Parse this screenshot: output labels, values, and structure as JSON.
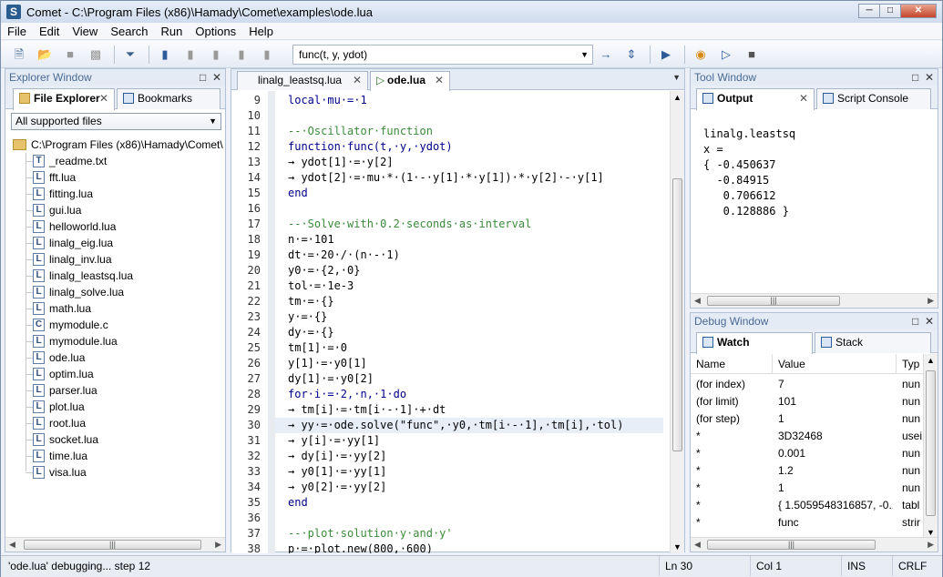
{
  "window": {
    "title": "Comet - C:\\Program Files (x86)\\Hamady\\Comet\\examples\\ode.lua",
    "buttons": [
      "minimize",
      "maximize",
      "close"
    ]
  },
  "menu": [
    "File",
    "Edit",
    "View",
    "Search",
    "Run",
    "Options",
    "Help"
  ],
  "toolbar": {
    "function_combo": "func(t, y, ydot)"
  },
  "explorer": {
    "title": "Explorer Window",
    "tabs": [
      {
        "label": "File Explorer",
        "active": true
      },
      {
        "label": "Bookmarks",
        "active": false
      }
    ],
    "filter": "All supported files",
    "root": "C:\\Program Files (x86)\\Hamady\\Comet\\",
    "files": [
      {
        "name": "_readme.txt",
        "icon": "T"
      },
      {
        "name": "fft.lua",
        "icon": "L"
      },
      {
        "name": "fitting.lua",
        "icon": "L"
      },
      {
        "name": "gui.lua",
        "icon": "L"
      },
      {
        "name": "helloworld.lua",
        "icon": "L"
      },
      {
        "name": "linalg_eig.lua",
        "icon": "L"
      },
      {
        "name": "linalg_inv.lua",
        "icon": "L"
      },
      {
        "name": "linalg_leastsq.lua",
        "icon": "L"
      },
      {
        "name": "linalg_solve.lua",
        "icon": "L"
      },
      {
        "name": "math.lua",
        "icon": "L"
      },
      {
        "name": "mymodule.c",
        "icon": "C"
      },
      {
        "name": "mymodule.lua",
        "icon": "L"
      },
      {
        "name": "ode.lua",
        "icon": "L"
      },
      {
        "name": "optim.lua",
        "icon": "L"
      },
      {
        "name": "parser.lua",
        "icon": "L"
      },
      {
        "name": "plot.lua",
        "icon": "L"
      },
      {
        "name": "root.lua",
        "icon": "L"
      },
      {
        "name": "socket.lua",
        "icon": "L"
      },
      {
        "name": "time.lua",
        "icon": "L"
      },
      {
        "name": "visa.lua",
        "icon": "L"
      }
    ]
  },
  "editor": {
    "tabs": [
      {
        "label": "linalg_leastsq.lua",
        "active": false
      },
      {
        "label": "ode.lua",
        "active": true
      }
    ],
    "current_line": 30,
    "lines": [
      {
        "n": "9",
        "t": "local·mu·=·1"
      },
      {
        "n": "10",
        "t": ""
      },
      {
        "n": "11",
        "t": "--·Oscillator·function"
      },
      {
        "n": "12",
        "t": "function·func(t,·y,·ydot)"
      },
      {
        "n": "13",
        "t": "→ ydot[1]·=·y[2]"
      },
      {
        "n": "14",
        "t": "→ ydot[2]·=·mu·*·(1·-·y[1]·*·y[1])·*·y[2]·-·y[1]"
      },
      {
        "n": "15",
        "t": "end"
      },
      {
        "n": "16",
        "t": ""
      },
      {
        "n": "17",
        "t": "--·Solve·with·0.2·seconds·as·interval"
      },
      {
        "n": "18",
        "t": "n·=·101"
      },
      {
        "n": "19",
        "t": "dt·=·20·/·(n·-·1)"
      },
      {
        "n": "20",
        "t": "y0·=·{2,·0}"
      },
      {
        "n": "21",
        "t": "tol·=·1e-3"
      },
      {
        "n": "22",
        "t": "tm·=·{}"
      },
      {
        "n": "23",
        "t": "y·=·{}"
      },
      {
        "n": "24",
        "t": "dy·=·{}"
      },
      {
        "n": "25",
        "t": "tm[1]·=·0"
      },
      {
        "n": "26",
        "t": "y[1]·=·y0[1]"
      },
      {
        "n": "27",
        "t": "dy[1]·=·y0[2]"
      },
      {
        "n": "28",
        "t": "for·i·=·2,·n,·1·do"
      },
      {
        "n": "29",
        "t": "→ tm[i]·=·tm[i·-·1]·+·dt"
      },
      {
        "n": "30",
        "t": "→ yy·=·ode.solve(\"func\",·y0,·tm[i·-·1],·tm[i],·tol)"
      },
      {
        "n": "31",
        "t": "→ y[i]·=·yy[1]"
      },
      {
        "n": "32",
        "t": "→ dy[i]·=·yy[2]"
      },
      {
        "n": "33",
        "t": "→ y0[1]·=·yy[1]"
      },
      {
        "n": "34",
        "t": "→ y0[2]·=·yy[2]"
      },
      {
        "n": "35",
        "t": "end"
      },
      {
        "n": "36",
        "t": ""
      },
      {
        "n": "37",
        "t": "--·plot·solution·y·and·y'"
      },
      {
        "n": "38",
        "t": "p·=·plot.new(800,·600)"
      }
    ]
  },
  "tool": {
    "title": "Tool Window",
    "tabs": [
      {
        "label": "Output",
        "active": true
      },
      {
        "label": "Script Console",
        "active": false
      }
    ],
    "output": "linalg.leastsq\nx =\n{ -0.450637\n  -0.84915\n   0.706612\n   0.128886 }"
  },
  "debug": {
    "title": "Debug Window",
    "tabs": [
      {
        "label": "Watch",
        "active": true
      },
      {
        "label": "Stack",
        "active": false
      }
    ],
    "columns": [
      "Name",
      "Value",
      "Typ"
    ],
    "rows": [
      [
        "(for index)",
        "7",
        "nun"
      ],
      [
        "(for limit)",
        "101",
        "nun"
      ],
      [
        "(for step)",
        "1",
        "nun"
      ],
      [
        "*",
        "3D32468",
        "usei"
      ],
      [
        "*",
        "0.001",
        "nun"
      ],
      [
        "*",
        "1.2",
        "nun"
      ],
      [
        "*",
        "1",
        "nun"
      ],
      [
        "*",
        "{ 1.5059548316857, -0....",
        "tabl"
      ],
      [
        "*",
        "func",
        "strir"
      ]
    ]
  },
  "status": {
    "message": "'ode.lua' debugging... step 12",
    "line": "Ln 30",
    "col": "Col 1",
    "mode": "INS",
    "eol": "CRLF"
  }
}
